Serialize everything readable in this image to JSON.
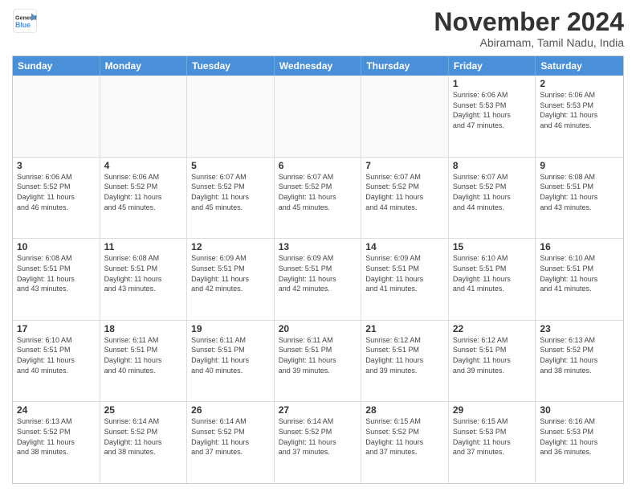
{
  "header": {
    "logo_line1": "General",
    "logo_line2": "Blue",
    "month": "November 2024",
    "location": "Abiramam, Tamil Nadu, India"
  },
  "days": [
    "Sunday",
    "Monday",
    "Tuesday",
    "Wednesday",
    "Thursday",
    "Friday",
    "Saturday"
  ],
  "weeks": [
    [
      {
        "day": "",
        "info": ""
      },
      {
        "day": "",
        "info": ""
      },
      {
        "day": "",
        "info": ""
      },
      {
        "day": "",
        "info": ""
      },
      {
        "day": "",
        "info": ""
      },
      {
        "day": "1",
        "info": "Sunrise: 6:06 AM\nSunset: 5:53 PM\nDaylight: 11 hours\nand 47 minutes."
      },
      {
        "day": "2",
        "info": "Sunrise: 6:06 AM\nSunset: 5:53 PM\nDaylight: 11 hours\nand 46 minutes."
      }
    ],
    [
      {
        "day": "3",
        "info": "Sunrise: 6:06 AM\nSunset: 5:52 PM\nDaylight: 11 hours\nand 46 minutes."
      },
      {
        "day": "4",
        "info": "Sunrise: 6:06 AM\nSunset: 5:52 PM\nDaylight: 11 hours\nand 45 minutes."
      },
      {
        "day": "5",
        "info": "Sunrise: 6:07 AM\nSunset: 5:52 PM\nDaylight: 11 hours\nand 45 minutes."
      },
      {
        "day": "6",
        "info": "Sunrise: 6:07 AM\nSunset: 5:52 PM\nDaylight: 11 hours\nand 45 minutes."
      },
      {
        "day": "7",
        "info": "Sunrise: 6:07 AM\nSunset: 5:52 PM\nDaylight: 11 hours\nand 44 minutes."
      },
      {
        "day": "8",
        "info": "Sunrise: 6:07 AM\nSunset: 5:52 PM\nDaylight: 11 hours\nand 44 minutes."
      },
      {
        "day": "9",
        "info": "Sunrise: 6:08 AM\nSunset: 5:51 PM\nDaylight: 11 hours\nand 43 minutes."
      }
    ],
    [
      {
        "day": "10",
        "info": "Sunrise: 6:08 AM\nSunset: 5:51 PM\nDaylight: 11 hours\nand 43 minutes."
      },
      {
        "day": "11",
        "info": "Sunrise: 6:08 AM\nSunset: 5:51 PM\nDaylight: 11 hours\nand 43 minutes."
      },
      {
        "day": "12",
        "info": "Sunrise: 6:09 AM\nSunset: 5:51 PM\nDaylight: 11 hours\nand 42 minutes."
      },
      {
        "day": "13",
        "info": "Sunrise: 6:09 AM\nSunset: 5:51 PM\nDaylight: 11 hours\nand 42 minutes."
      },
      {
        "day": "14",
        "info": "Sunrise: 6:09 AM\nSunset: 5:51 PM\nDaylight: 11 hours\nand 41 minutes."
      },
      {
        "day": "15",
        "info": "Sunrise: 6:10 AM\nSunset: 5:51 PM\nDaylight: 11 hours\nand 41 minutes."
      },
      {
        "day": "16",
        "info": "Sunrise: 6:10 AM\nSunset: 5:51 PM\nDaylight: 11 hours\nand 41 minutes."
      }
    ],
    [
      {
        "day": "17",
        "info": "Sunrise: 6:10 AM\nSunset: 5:51 PM\nDaylight: 11 hours\nand 40 minutes."
      },
      {
        "day": "18",
        "info": "Sunrise: 6:11 AM\nSunset: 5:51 PM\nDaylight: 11 hours\nand 40 minutes."
      },
      {
        "day": "19",
        "info": "Sunrise: 6:11 AM\nSunset: 5:51 PM\nDaylight: 11 hours\nand 40 minutes."
      },
      {
        "day": "20",
        "info": "Sunrise: 6:11 AM\nSunset: 5:51 PM\nDaylight: 11 hours\nand 39 minutes."
      },
      {
        "day": "21",
        "info": "Sunrise: 6:12 AM\nSunset: 5:51 PM\nDaylight: 11 hours\nand 39 minutes."
      },
      {
        "day": "22",
        "info": "Sunrise: 6:12 AM\nSunset: 5:51 PM\nDaylight: 11 hours\nand 39 minutes."
      },
      {
        "day": "23",
        "info": "Sunrise: 6:13 AM\nSunset: 5:52 PM\nDaylight: 11 hours\nand 38 minutes."
      }
    ],
    [
      {
        "day": "24",
        "info": "Sunrise: 6:13 AM\nSunset: 5:52 PM\nDaylight: 11 hours\nand 38 minutes."
      },
      {
        "day": "25",
        "info": "Sunrise: 6:14 AM\nSunset: 5:52 PM\nDaylight: 11 hours\nand 38 minutes."
      },
      {
        "day": "26",
        "info": "Sunrise: 6:14 AM\nSunset: 5:52 PM\nDaylight: 11 hours\nand 37 minutes."
      },
      {
        "day": "27",
        "info": "Sunrise: 6:14 AM\nSunset: 5:52 PM\nDaylight: 11 hours\nand 37 minutes."
      },
      {
        "day": "28",
        "info": "Sunrise: 6:15 AM\nSunset: 5:52 PM\nDaylight: 11 hours\nand 37 minutes."
      },
      {
        "day": "29",
        "info": "Sunrise: 6:15 AM\nSunset: 5:53 PM\nDaylight: 11 hours\nand 37 minutes."
      },
      {
        "day": "30",
        "info": "Sunrise: 6:16 AM\nSunset: 5:53 PM\nDaylight: 11 hours\nand 36 minutes."
      }
    ]
  ]
}
